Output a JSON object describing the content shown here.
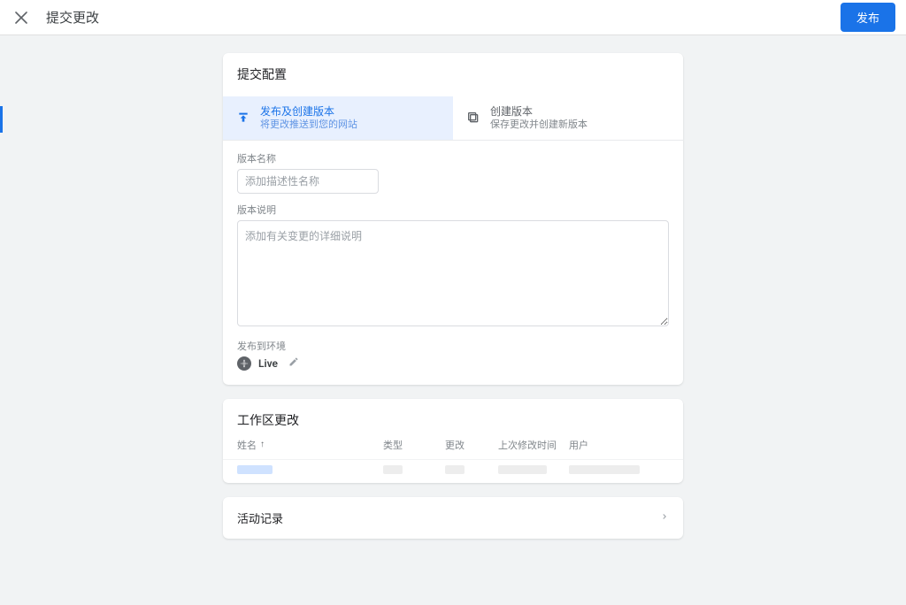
{
  "header": {
    "title": "提交更改",
    "publish_label": "发布"
  },
  "config": {
    "heading": "提交配置",
    "tabs": {
      "publish": {
        "title": "发布及创建版本",
        "desc": "将更改推送到您的网站"
      },
      "create": {
        "title": "创建版本",
        "desc": "保存更改并创建新版本"
      }
    },
    "version_name_label": "版本名称",
    "version_name_placeholder": "添加描述性名称",
    "version_desc_label": "版本说明",
    "version_desc_placeholder": "添加有关变更的详细说明",
    "publish_env_label": "发布到环境",
    "env_name": "Live"
  },
  "workspace": {
    "heading": "工作区更改",
    "columns": {
      "name": "姓名",
      "type": "类型",
      "change": "更改",
      "last_modified": "上次修改时间",
      "user": "用户"
    }
  },
  "activity": {
    "heading": "活动记录"
  }
}
